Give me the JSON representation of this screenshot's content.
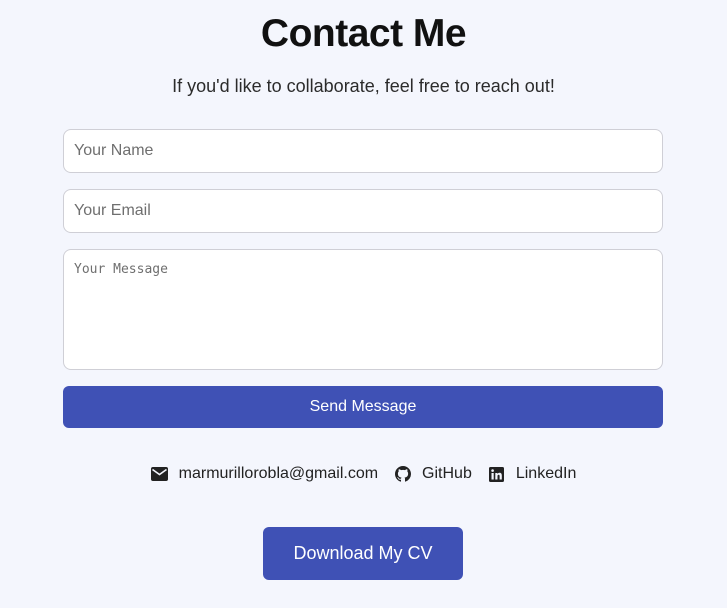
{
  "header": {
    "title": "Contact Me",
    "subtitle": "If you'd like to collaborate, feel free to reach out!"
  },
  "form": {
    "name_placeholder": "Your Name",
    "name_value": "",
    "email_placeholder": "Your Email",
    "email_value": "",
    "message_placeholder": "Your Message",
    "message_value": "",
    "send_label": "Send Message"
  },
  "links": {
    "email": {
      "label": "marmurillorobla@gmail.com",
      "icon": "envelope-icon"
    },
    "github": {
      "label": "GitHub",
      "icon": "github-icon"
    },
    "linkedin": {
      "label": "LinkedIn",
      "icon": "linkedin-icon"
    }
  },
  "download": {
    "label": "Download My CV"
  },
  "colors": {
    "background": "#f4f6fd",
    "accent": "#3f51b5"
  }
}
